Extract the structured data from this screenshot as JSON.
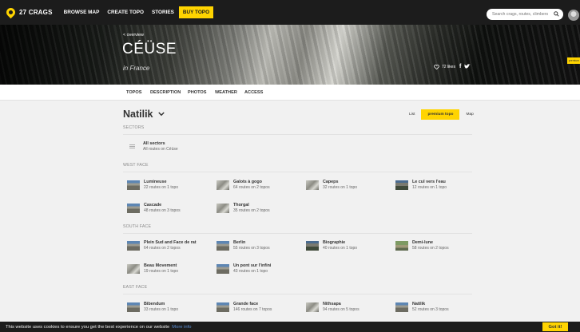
{
  "nav": {
    "logo": "27 CRAGS",
    "items": [
      "BROWSE MAP",
      "CREATE TOPO",
      "STORIES"
    ],
    "buy_label": "BUY TOPO",
    "search_placeholder": "Search crags, routes, climbers"
  },
  "hero": {
    "back": "< overview",
    "title": "CÉÜSE",
    "subtitle": "in France",
    "likes": "72 likes",
    "corner_badge": "premium"
  },
  "tabs": [
    "TOPOS",
    "DESCRIPTION",
    "PHOTOS",
    "WEATHER",
    "ACCESS"
  ],
  "main": {
    "crag_name": "Natilik",
    "sectors_label": "SECTORS",
    "view_list": "List",
    "view_premium": "premium topo",
    "view_map": "Map",
    "all_sectors": {
      "title": "All sectors",
      "subtitle": "All routes on Céüse"
    }
  },
  "groups": [
    {
      "label": "WEST FACE",
      "sectors": [
        {
          "name": "Lumineuse",
          "routes": "22 routes on 1 topo",
          "thumb": "blue"
        },
        {
          "name": "Galots à gogo",
          "routes": "64 routes on 2 topos",
          "thumb": "rock"
        },
        {
          "name": "Capeps",
          "routes": "32 routes on 1 topo",
          "thumb": "rock"
        },
        {
          "name": "Le cul vers l'eau",
          "routes": "12 routes on 1 topo",
          "thumb": "dark"
        },
        {
          "name": "Cascade",
          "routes": "48 routes on 3 topos",
          "thumb": "blue"
        },
        {
          "name": "Thorgal",
          "routes": "35 routes on 2 topos",
          "thumb": "rock"
        }
      ]
    },
    {
      "label": "SOUTH FACE",
      "sectors": [
        {
          "name": "Plein Sud and Face de rat",
          "routes": "64 routes on 2 topos",
          "thumb": "blue"
        },
        {
          "name": "Berlin",
          "routes": "55 routes on 3 topos",
          "thumb": "blue"
        },
        {
          "name": "Biographie",
          "routes": "40 routes on 1 topo",
          "thumb": "dark"
        },
        {
          "name": "Demi-lune",
          "routes": "58 routes on 2 topos",
          "thumb": "green"
        },
        {
          "name": "Beau Movement",
          "routes": "19 routes on 1 topo",
          "thumb": "rock"
        },
        {
          "name": "Un pont sur l'infini",
          "routes": "43 routes on 1 topo",
          "thumb": "blue"
        }
      ]
    },
    {
      "label": "EAST FACE",
      "sectors": [
        {
          "name": "Bibendum",
          "routes": "33 routes on 1 topo",
          "thumb": "blue"
        },
        {
          "name": "Grande face",
          "routes": "146 routes on 7 topos",
          "thumb": "blue"
        },
        {
          "name": "Nithsapa",
          "routes": "94 routes on 5 topos",
          "thumb": "rock"
        },
        {
          "name": "Natilik",
          "routes": "52 routes on 3 topos",
          "thumb": "blue"
        }
      ]
    }
  ],
  "cookie": {
    "text": "This website uses cookies to ensure you get the best experience on our website",
    "link": "More info",
    "button": "Got it!"
  }
}
